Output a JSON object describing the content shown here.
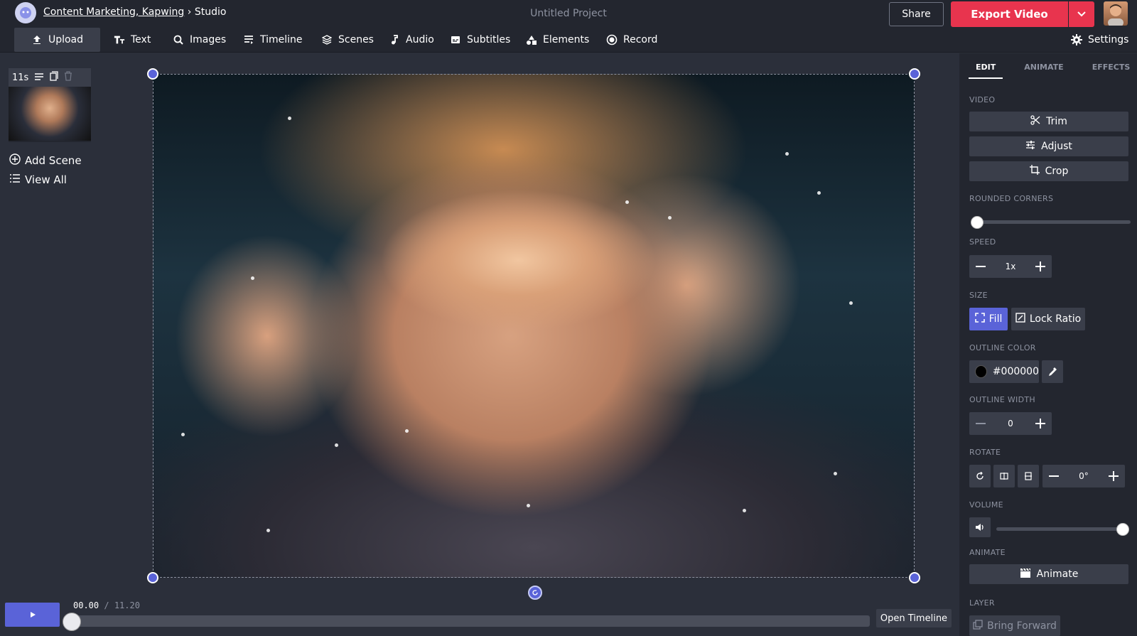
{
  "header": {
    "breadcrumb_link": "Content Marketing, Kapwing",
    "breadcrumb_sep": "›",
    "breadcrumb_current": "Studio",
    "project_title": "Untitled Project",
    "share_label": "Share",
    "export_label": "Export Video"
  },
  "nav": {
    "items": [
      {
        "label": "Upload",
        "icon": "upload-icon"
      },
      {
        "label": "Text",
        "icon": "text-icon"
      },
      {
        "label": "Images",
        "icon": "search-icon"
      },
      {
        "label": "Timeline",
        "icon": "timeline-icon"
      },
      {
        "label": "Scenes",
        "icon": "layers-icon"
      },
      {
        "label": "Audio",
        "icon": "music-note-icon"
      },
      {
        "label": "Subtitles",
        "icon": "subtitles-icon"
      },
      {
        "label": "Elements",
        "icon": "shapes-icon"
      },
      {
        "label": "Record",
        "icon": "record-icon"
      }
    ],
    "settings_label": "Settings"
  },
  "scenes": {
    "duration": "11s",
    "add_scene_label": "Add Scene",
    "view_all_label": "View All"
  },
  "playback": {
    "current_time": "00.00",
    "separator": "/",
    "total_time": "11.20",
    "progress": 0,
    "open_timeline_label": "Open Timeline"
  },
  "panel": {
    "tabs": [
      "EDIT",
      "ANIMATE",
      "EFFECTS"
    ],
    "active_tab": "EDIT",
    "video_label": "VIDEO",
    "trim_label": "Trim",
    "adjust_label": "Adjust",
    "crop_label": "Crop",
    "rounded_corners_label": "ROUNDED CORNERS",
    "rounded_corners_value": 0,
    "speed_label": "SPEED",
    "speed_value": "1x",
    "size_label": "SIZE",
    "fill_label": "Fill",
    "lock_ratio_label": "Lock Ratio",
    "outline_color_label": "OUTLINE COLOR",
    "outline_color_value": "#000000",
    "outline_width_label": "OUTLINE WIDTH",
    "outline_width_value": "0",
    "rotate_label": "ROTATE",
    "rotate_value": "0°",
    "volume_label": "VOLUME",
    "volume_level": 1.0,
    "animate_section_label": "ANIMATE",
    "animate_button_label": "Animate",
    "layer_label": "LAYER",
    "bring_forward_label": "Bring Forward"
  },
  "colors": {
    "accent": "#5a63d8",
    "export": "#e8344e",
    "background": "#2b2f3a",
    "panel": "#23262f"
  }
}
